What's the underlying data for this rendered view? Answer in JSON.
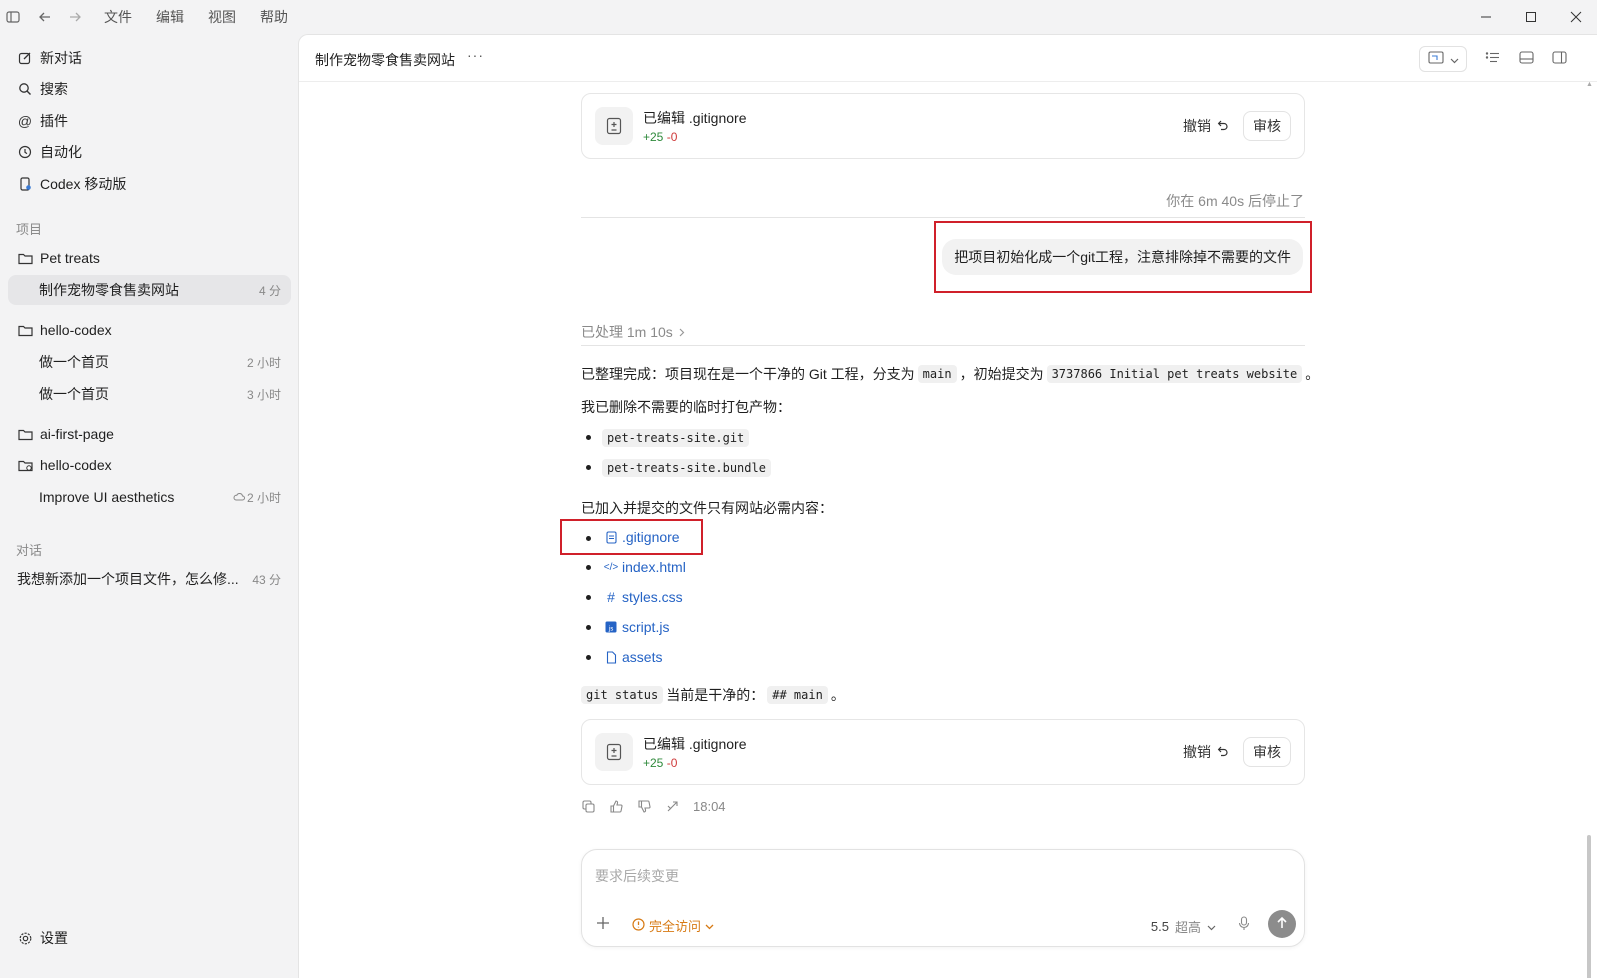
{
  "menu": [
    "文件",
    "编辑",
    "视图",
    "帮助"
  ],
  "sidebar": {
    "top_items": [
      {
        "label": "新对话",
        "icon": "edit-icon"
      },
      {
        "label": "搜索",
        "icon": "search-icon"
      },
      {
        "label": "插件",
        "icon": "at-icon"
      },
      {
        "label": "自动化",
        "icon": "clock-icon"
      },
      {
        "label": "Codex 移动版",
        "icon": "phone-icon"
      }
    ],
    "projects_label": "项目",
    "projects": [
      {
        "label": "Pet treats",
        "threads": [
          {
            "label": "制作宠物零食售卖网站",
            "time": "4 分",
            "active": true
          }
        ]
      },
      {
        "label": "hello-codex",
        "threads": [
          {
            "label": "做一个首页",
            "time": "2 小时"
          },
          {
            "label": "做一个首页",
            "time": "3 小时"
          }
        ]
      },
      {
        "label": "ai-first-page",
        "threads": []
      },
      {
        "label": "hello-codex",
        "threads": [
          {
            "label": "Improve UI aesthetics",
            "time": "2 小时",
            "cloud": true
          }
        ]
      }
    ],
    "chats_label": "对话",
    "chats": [
      {
        "label": "我想新添加一个项目文件，怎么修...",
        "time": "43 分"
      }
    ],
    "settings_label": "设置"
  },
  "header": {
    "title": "制作宠物零食售卖网站",
    "more": "···"
  },
  "edit_card": {
    "title": "已编辑 .gitignore",
    "added": "+25",
    "removed": "-0",
    "undo": "撤销",
    "review": "审核"
  },
  "stopped_text": "你在 6m 40s 后停止了",
  "user_message": "把项目初始化成一个git工程，注意排除掉不需要的文件",
  "processed_text": "已处理 1m 10s",
  "response": {
    "p1_a": "已整理完成：项目现在是一个干净的 Git 工程，分支为",
    "p1_code1": "main",
    "p1_b": "，初始提交为",
    "p1_code2": "3737866 Initial pet treats website",
    "p1_c": "。",
    "p2": "我已删除不需要的临时打包产物：",
    "deleted": [
      "pet-treats-site.git",
      "pet-treats-site.bundle"
    ],
    "p3": "已加入并提交的文件只有网站必需内容：",
    "files": [
      {
        "name": ".gitignore",
        "icon": "file-text-icon"
      },
      {
        "name": "index.html",
        "icon": "code-icon"
      },
      {
        "name": "styles.css",
        "icon": "hash-icon"
      },
      {
        "name": "script.js",
        "icon": "js-icon"
      },
      {
        "name": "assets",
        "icon": "file-icon"
      }
    ],
    "p4_code1": "git status",
    "p4_a": "当前是干净的：",
    "p4_code2": "## main",
    "p4_b": "。"
  },
  "message_time": "18:04",
  "composer": {
    "placeholder": "要求后续变更",
    "access": "完全访问",
    "model": "5.5",
    "effort": "超高"
  }
}
